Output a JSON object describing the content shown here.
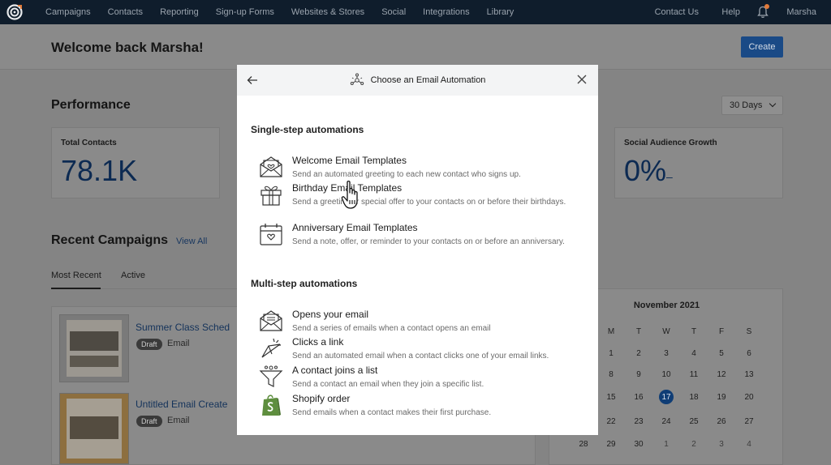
{
  "nav": {
    "items": [
      "Campaigns",
      "Contacts",
      "Reporting",
      "Sign-up Forms",
      "Websites & Stores",
      "Social",
      "Integrations",
      "Library"
    ],
    "contact_us": "Contact Us",
    "help": "Help",
    "user": "Marsha"
  },
  "header": {
    "welcome": "Welcome back Marsha!",
    "create_label": "Create"
  },
  "performance": {
    "title": "Performance",
    "range": "30 Days",
    "total_contacts_label": "Total Contacts",
    "total_contacts_value": "78.1K",
    "social_label": "Social Audience Growth",
    "social_value": "0%",
    "social_dash": "–"
  },
  "recent": {
    "title": "Recent Campaigns",
    "view_all": "View All",
    "tabs": [
      "Most Recent",
      "Active"
    ],
    "campaigns": [
      {
        "name": "Summer Class Sched",
        "status": "Draft",
        "type": "Email"
      },
      {
        "name": "Untitled Email Create",
        "status": "Draft",
        "type": "Email"
      }
    ]
  },
  "calendar": {
    "month": "November 2021",
    "weekdays": [
      "M",
      "T",
      "W",
      "T",
      "F",
      "S"
    ],
    "weeks": [
      [
        "1",
        "2",
        "3",
        "4",
        "5",
        "6"
      ],
      [
        "8",
        "9",
        "10",
        "11",
        "12",
        "13"
      ],
      [
        "15",
        "16",
        "17",
        "18",
        "19",
        "20"
      ],
      [
        "22",
        "23",
        "24",
        "25",
        "26",
        "27"
      ],
      [
        "29",
        "30",
        "1",
        "2",
        "3",
        "4"
      ]
    ],
    "left_col": [
      "28"
    ],
    "today": "17"
  },
  "modal": {
    "title": "Choose an Email Automation",
    "single_title": "Single-step automations",
    "single": [
      {
        "icon": "envelope-open-icon",
        "title": "Welcome Email Templates",
        "desc": "Send an automated greeting to each new contact who signs up."
      },
      {
        "icon": "gift-icon",
        "title": "Birthday Email Templates",
        "desc": "Send a greeting or special offer to your contacts on or before their birthdays."
      },
      {
        "icon": "calendar-heart-icon",
        "title": "Anniversary Email Templates",
        "desc": "Send a note, offer, or reminder to your contacts on or before an anniversary."
      }
    ],
    "multi_title": "Multi-step automations",
    "multi": [
      {
        "icon": "envelope-open-icon",
        "title": "Opens your email",
        "desc": "Send a series of emails when a contact opens an email"
      },
      {
        "icon": "click-pointer-icon",
        "title": "Clicks a link",
        "desc": "Send an automated email when a contact clicks one of your email links."
      },
      {
        "icon": "funnel-icon",
        "title": "A contact joins a list",
        "desc": "Send a contact an email when they join a specific list."
      },
      {
        "icon": "shopify-icon",
        "title": "Shopify order",
        "desc": "Send emails when a contact makes their first purchase."
      }
    ]
  },
  "colors": {
    "nav_bg": "#0f1d2c",
    "accent": "#1a4a86",
    "shopify_green": "#5e8e3e"
  }
}
